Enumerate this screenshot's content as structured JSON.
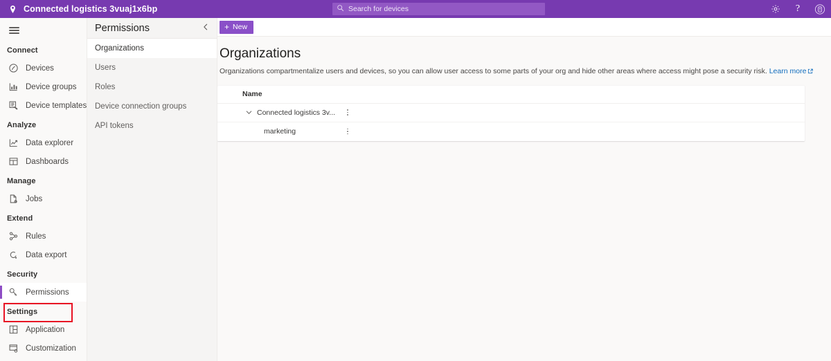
{
  "header": {
    "pin_icon": "location-pin-icon",
    "app_title": "Connected logistics 3vuaj1x6bp",
    "search": {
      "icon": "search-icon",
      "placeholder": "Search for devices",
      "value": ""
    },
    "actions": [
      {
        "name": "settings-gear-icon",
        "glyph": "gear"
      },
      {
        "name": "help-icon",
        "glyph": "?"
      },
      {
        "name": "account-avatar-icon",
        "glyph": "account"
      }
    ],
    "colors": {
      "bar": "#773ab0",
      "search_bg": "#9258c4"
    }
  },
  "sidebar": {
    "menu_icon": "hamburger-menu-icon",
    "groups": [
      {
        "label": "Connect",
        "items": [
          {
            "label": "Devices",
            "icon": "devices-icon"
          },
          {
            "label": "Device groups",
            "icon": "device-groups-icon"
          },
          {
            "label": "Device templates",
            "icon": "device-templates-icon"
          }
        ]
      },
      {
        "label": "Analyze",
        "items": [
          {
            "label": "Data explorer",
            "icon": "data-explorer-icon"
          },
          {
            "label": "Dashboards",
            "icon": "dashboards-icon"
          }
        ]
      },
      {
        "label": "Manage",
        "items": [
          {
            "label": "Jobs",
            "icon": "jobs-icon"
          }
        ]
      },
      {
        "label": "Extend",
        "items": [
          {
            "label": "Rules",
            "icon": "rules-icon"
          },
          {
            "label": "Data export",
            "icon": "data-export-icon"
          }
        ]
      },
      {
        "label": "Security",
        "items": [
          {
            "label": "Permissions",
            "icon": "permissions-key-icon",
            "selected": true,
            "highlighted": true
          }
        ]
      },
      {
        "label": "Settings",
        "items": [
          {
            "label": "Application",
            "icon": "application-icon"
          },
          {
            "label": "Customization",
            "icon": "customization-icon"
          }
        ]
      }
    ],
    "highlight_color": "#e81123",
    "selected_accent": "#8e4dc4"
  },
  "subpanel": {
    "title": "Permissions",
    "collapse_icon": "chevron-left-icon",
    "items": [
      {
        "label": "Organizations",
        "active": true
      },
      {
        "label": "Users",
        "active": false
      },
      {
        "label": "Roles",
        "active": false
      },
      {
        "label": "Device connection groups",
        "active": false
      },
      {
        "label": "API tokens",
        "active": false
      }
    ]
  },
  "main": {
    "command_bar": {
      "new_label": "New",
      "new_icon": "plus-icon",
      "new_color": "#8a4fc8"
    },
    "page_title": "Organizations",
    "description": "Organizations compartmentalize users and devices, so you can allow user access to some parts of your org and hide other areas where access might pose a security risk.",
    "learn_more_label": "Learn more",
    "learn_more_icon": "external-link-icon",
    "learn_more_color": "#0f6cbd",
    "table": {
      "columns": [
        "Name"
      ],
      "rows": [
        {
          "name": "Connected logistics 3v...",
          "expander": "chevron-down-icon",
          "child": false,
          "menu": "more-options-icon"
        },
        {
          "name": "marketing",
          "expander": "",
          "child": true,
          "menu": "more-options-icon"
        }
      ]
    }
  }
}
